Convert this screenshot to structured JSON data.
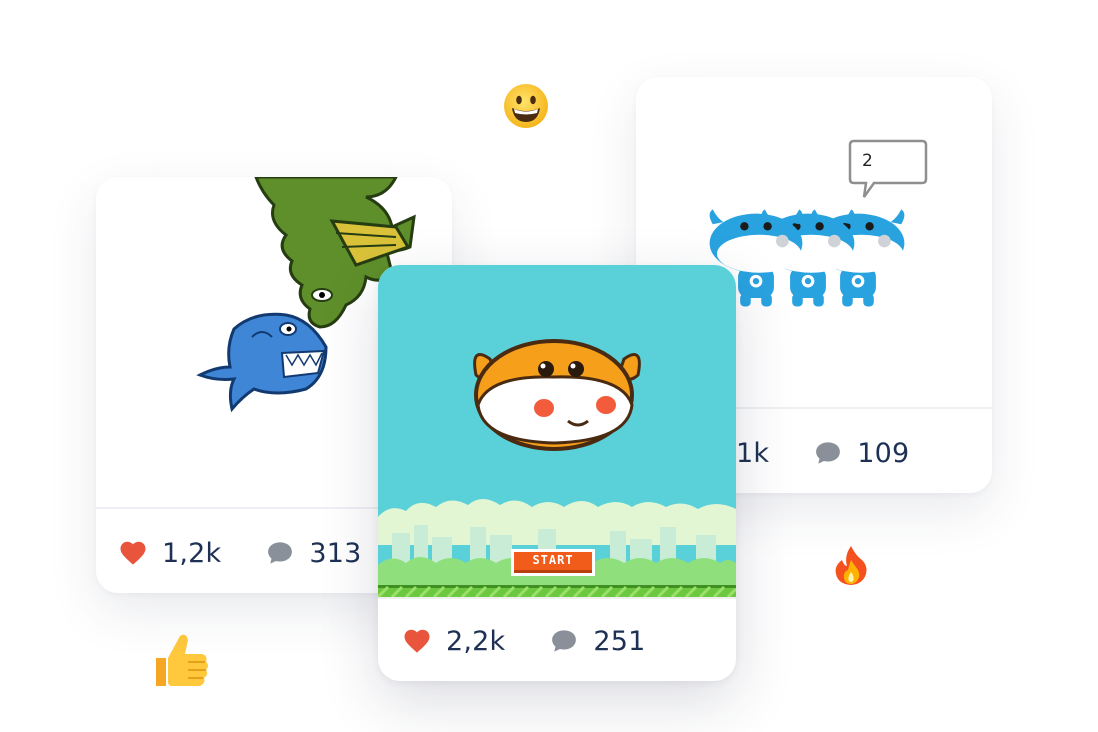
{
  "cards": [
    {
      "id": "shark-dragon",
      "likes": "1,2k",
      "comments": "313",
      "like_icon": "heart-icon",
      "comment_icon": "comment-bubble-icon"
    },
    {
      "id": "cow-trio",
      "likes": "1k",
      "comments": "109",
      "speech_bubble_text": "2",
      "like_icon": "heart-icon",
      "comment_icon": "comment-bubble-icon"
    },
    {
      "id": "flappy-cow",
      "likes": "2,2k",
      "comments": "251",
      "start_label": "START",
      "like_icon": "heart-icon",
      "comment_icon": "comment-bubble-icon"
    }
  ],
  "decorations": [
    "grinning-face-emoji",
    "thumbs-up-emoji",
    "fire-emoji"
  ],
  "colors": {
    "heart": "#e8553c",
    "comment": "#8a9099",
    "text": "#1e3154",
    "sky": "#5ad0d9",
    "start_button": "#f25c1a"
  }
}
